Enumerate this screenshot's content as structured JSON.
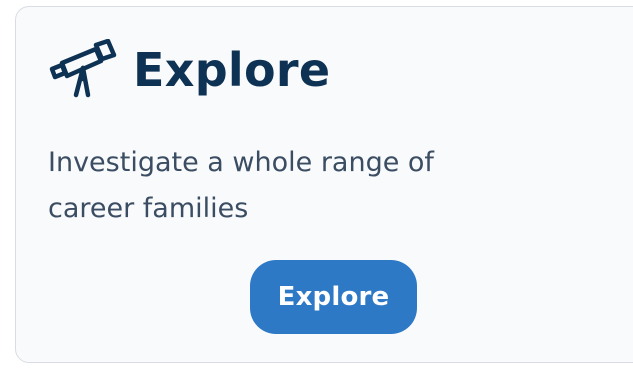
{
  "card": {
    "icon": "telescope-icon",
    "title": "Explore",
    "description": "Investigate a whole range of career families",
    "button_label": "Explore"
  },
  "colors": {
    "card_background": "#f9fafc",
    "card_border": "#d9dde3",
    "title": "#0d3253",
    "description": "#3b4d62",
    "button_background": "#2e79c6",
    "button_text": "#ffffff"
  }
}
